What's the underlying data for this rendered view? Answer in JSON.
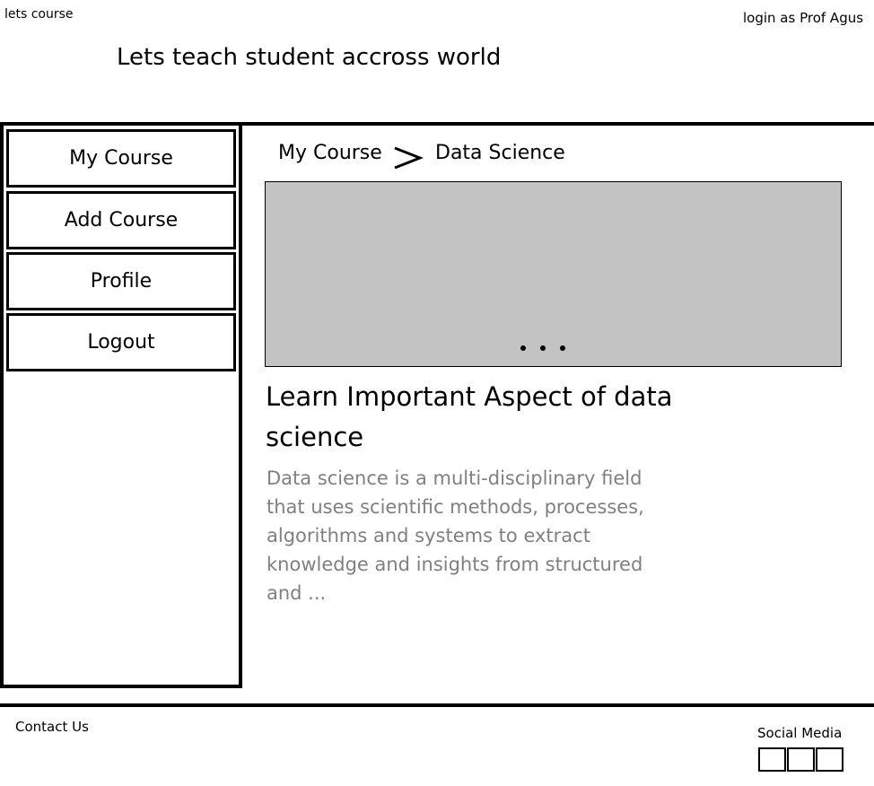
{
  "header": {
    "brand": "lets course",
    "login_text": "login as Prof Agus",
    "tagline": "Lets teach student accross world"
  },
  "sidebar": {
    "items": [
      {
        "label": "My Course"
      },
      {
        "label": "Add Course"
      },
      {
        "label": "Profile"
      },
      {
        "label": "Logout"
      }
    ]
  },
  "breadcrumb": {
    "items": [
      "My Course",
      "Data Science"
    ],
    "separator_icon": "chevron-right-icon"
  },
  "content": {
    "carousel": {
      "dot_count": 3,
      "color": "#c3c3c3"
    },
    "title": "Learn Important Aspect of data science",
    "description": "Data science is a multi-disciplinary field that uses scientific methods, processes, algorithms and systems to extract knowledge and insights from structured and ..."
  },
  "footer": {
    "contact": "Contact Us",
    "social_label": "Social Media",
    "social_icons": [
      "social-icon-1",
      "social-icon-2",
      "social-icon-3"
    ]
  }
}
